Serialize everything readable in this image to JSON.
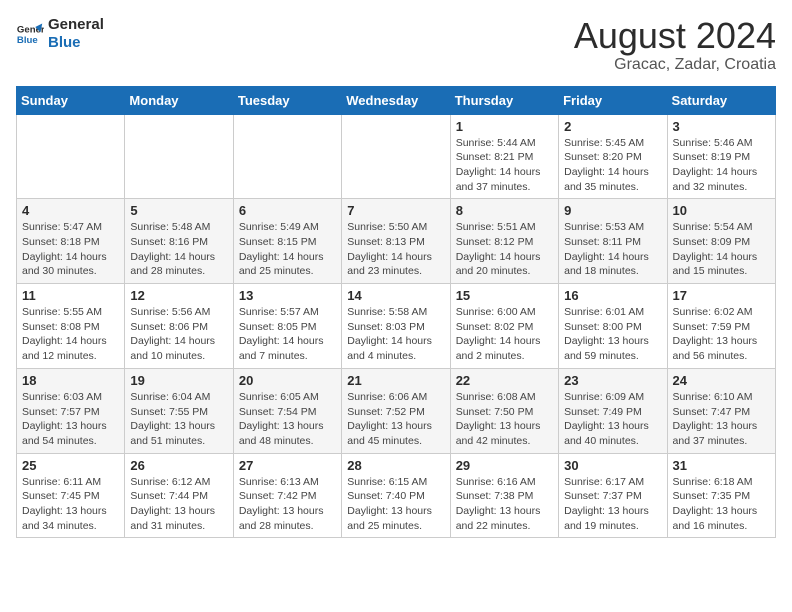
{
  "logo": {
    "line1": "General",
    "line2": "Blue"
  },
  "title": "August 2024",
  "subtitle": "Gracac, Zadar, Croatia",
  "weekdays": [
    "Sunday",
    "Monday",
    "Tuesday",
    "Wednesday",
    "Thursday",
    "Friday",
    "Saturday"
  ],
  "weeks": [
    [
      {
        "date": "",
        "info": ""
      },
      {
        "date": "",
        "info": ""
      },
      {
        "date": "",
        "info": ""
      },
      {
        "date": "",
        "info": ""
      },
      {
        "date": "1",
        "info": "Sunrise: 5:44 AM\nSunset: 8:21 PM\nDaylight: 14 hours and 37 minutes."
      },
      {
        "date": "2",
        "info": "Sunrise: 5:45 AM\nSunset: 8:20 PM\nDaylight: 14 hours and 35 minutes."
      },
      {
        "date": "3",
        "info": "Sunrise: 5:46 AM\nSunset: 8:19 PM\nDaylight: 14 hours and 32 minutes."
      }
    ],
    [
      {
        "date": "4",
        "info": "Sunrise: 5:47 AM\nSunset: 8:18 PM\nDaylight: 14 hours and 30 minutes."
      },
      {
        "date": "5",
        "info": "Sunrise: 5:48 AM\nSunset: 8:16 PM\nDaylight: 14 hours and 28 minutes."
      },
      {
        "date": "6",
        "info": "Sunrise: 5:49 AM\nSunset: 8:15 PM\nDaylight: 14 hours and 25 minutes."
      },
      {
        "date": "7",
        "info": "Sunrise: 5:50 AM\nSunset: 8:13 PM\nDaylight: 14 hours and 23 minutes."
      },
      {
        "date": "8",
        "info": "Sunrise: 5:51 AM\nSunset: 8:12 PM\nDaylight: 14 hours and 20 minutes."
      },
      {
        "date": "9",
        "info": "Sunrise: 5:53 AM\nSunset: 8:11 PM\nDaylight: 14 hours and 18 minutes."
      },
      {
        "date": "10",
        "info": "Sunrise: 5:54 AM\nSunset: 8:09 PM\nDaylight: 14 hours and 15 minutes."
      }
    ],
    [
      {
        "date": "11",
        "info": "Sunrise: 5:55 AM\nSunset: 8:08 PM\nDaylight: 14 hours and 12 minutes."
      },
      {
        "date": "12",
        "info": "Sunrise: 5:56 AM\nSunset: 8:06 PM\nDaylight: 14 hours and 10 minutes."
      },
      {
        "date": "13",
        "info": "Sunrise: 5:57 AM\nSunset: 8:05 PM\nDaylight: 14 hours and 7 minutes."
      },
      {
        "date": "14",
        "info": "Sunrise: 5:58 AM\nSunset: 8:03 PM\nDaylight: 14 hours and 4 minutes."
      },
      {
        "date": "15",
        "info": "Sunrise: 6:00 AM\nSunset: 8:02 PM\nDaylight: 14 hours and 2 minutes."
      },
      {
        "date": "16",
        "info": "Sunrise: 6:01 AM\nSunset: 8:00 PM\nDaylight: 13 hours and 59 minutes."
      },
      {
        "date": "17",
        "info": "Sunrise: 6:02 AM\nSunset: 7:59 PM\nDaylight: 13 hours and 56 minutes."
      }
    ],
    [
      {
        "date": "18",
        "info": "Sunrise: 6:03 AM\nSunset: 7:57 PM\nDaylight: 13 hours and 54 minutes."
      },
      {
        "date": "19",
        "info": "Sunrise: 6:04 AM\nSunset: 7:55 PM\nDaylight: 13 hours and 51 minutes."
      },
      {
        "date": "20",
        "info": "Sunrise: 6:05 AM\nSunset: 7:54 PM\nDaylight: 13 hours and 48 minutes."
      },
      {
        "date": "21",
        "info": "Sunrise: 6:06 AM\nSunset: 7:52 PM\nDaylight: 13 hours and 45 minutes."
      },
      {
        "date": "22",
        "info": "Sunrise: 6:08 AM\nSunset: 7:50 PM\nDaylight: 13 hours and 42 minutes."
      },
      {
        "date": "23",
        "info": "Sunrise: 6:09 AM\nSunset: 7:49 PM\nDaylight: 13 hours and 40 minutes."
      },
      {
        "date": "24",
        "info": "Sunrise: 6:10 AM\nSunset: 7:47 PM\nDaylight: 13 hours and 37 minutes."
      }
    ],
    [
      {
        "date": "25",
        "info": "Sunrise: 6:11 AM\nSunset: 7:45 PM\nDaylight: 13 hours and 34 minutes."
      },
      {
        "date": "26",
        "info": "Sunrise: 6:12 AM\nSunset: 7:44 PM\nDaylight: 13 hours and 31 minutes."
      },
      {
        "date": "27",
        "info": "Sunrise: 6:13 AM\nSunset: 7:42 PM\nDaylight: 13 hours and 28 minutes."
      },
      {
        "date": "28",
        "info": "Sunrise: 6:15 AM\nSunset: 7:40 PM\nDaylight: 13 hours and 25 minutes."
      },
      {
        "date": "29",
        "info": "Sunrise: 6:16 AM\nSunset: 7:38 PM\nDaylight: 13 hours and 22 minutes."
      },
      {
        "date": "30",
        "info": "Sunrise: 6:17 AM\nSunset: 7:37 PM\nDaylight: 13 hours and 19 minutes."
      },
      {
        "date": "31",
        "info": "Sunrise: 6:18 AM\nSunset: 7:35 PM\nDaylight: 13 hours and 16 minutes."
      }
    ]
  ]
}
